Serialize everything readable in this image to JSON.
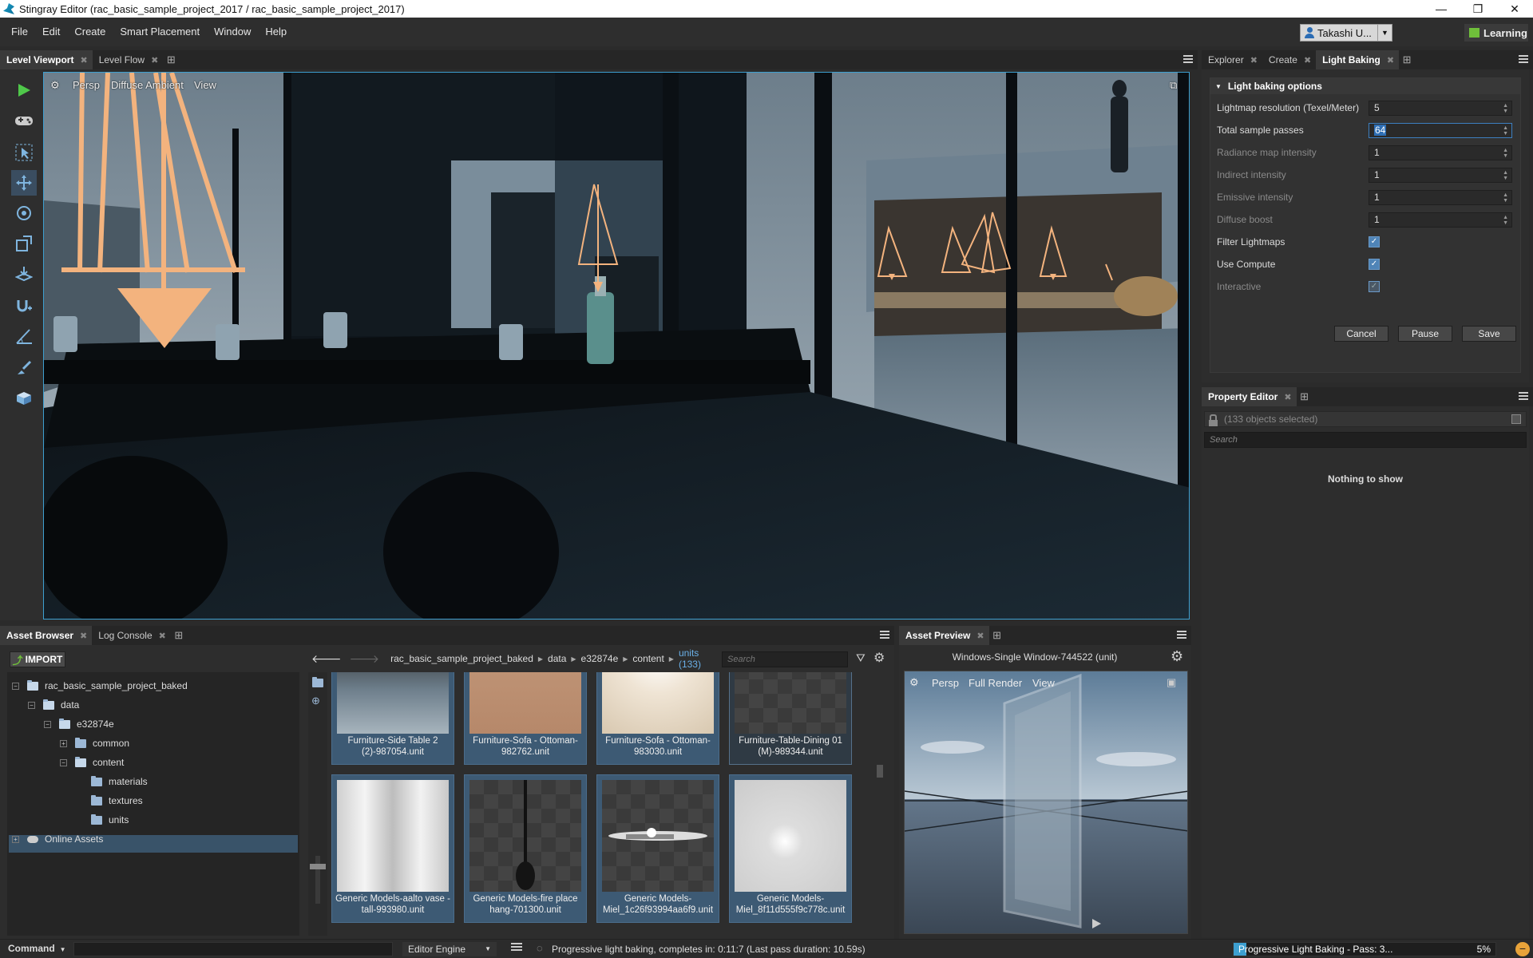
{
  "window": {
    "title": "Stingray Editor (rac_basic_sample_project_2017 / rac_basic_sample_project_2017)",
    "minimize": "—",
    "maximize": "❐",
    "close": "✕"
  },
  "menu": [
    "File",
    "Edit",
    "Create",
    "Smart Placement",
    "Window",
    "Help"
  ],
  "user": {
    "name": "Takashi U...",
    "learning_label": "Learning"
  },
  "viewport_tabs": [
    {
      "label": "Level Viewport",
      "active": true
    },
    {
      "label": "Level Flow",
      "active": false
    }
  ],
  "viewport": {
    "menu": [
      "Persp",
      "Diffuse Ambient",
      "View"
    ]
  },
  "right_tabs": [
    {
      "label": "Explorer"
    },
    {
      "label": "Create"
    },
    {
      "label": "Light Baking",
      "active": true
    }
  ],
  "light_baking": {
    "group_title": "Light baking options",
    "rows": [
      {
        "label": "Lightmap resolution (Texel/Meter)",
        "value": "5",
        "dim": false
      },
      {
        "label": "Total sample passes",
        "value": "64",
        "dim": false
      },
      {
        "label": "Radiance map intensity",
        "value": "1",
        "dim": true
      },
      {
        "label": "Indirect intensity",
        "value": "1",
        "dim": true
      },
      {
        "label": "Emissive intensity",
        "value": "1",
        "dim": true
      },
      {
        "label": "Diffuse boost",
        "value": "1",
        "dim": true
      }
    ],
    "checks": [
      {
        "label": "Filter Lightmaps",
        "checked": true,
        "dim": false
      },
      {
        "label": "Use Compute",
        "checked": true,
        "dim": false
      },
      {
        "label": "Interactive",
        "checked": true,
        "dim": true
      }
    ],
    "buttons": {
      "cancel": "Cancel",
      "pause": "Pause",
      "save": "Save"
    }
  },
  "property_editor": {
    "tab": "Property Editor",
    "filter": "(133 objects selected)",
    "search_placeholder": "Search",
    "empty": "Nothing to show"
  },
  "asset_browser": {
    "tabs": [
      {
        "label": "Asset Browser",
        "active": true
      },
      {
        "label": "Log Console",
        "active": false
      }
    ],
    "import_label": "IMPORT",
    "tree": [
      {
        "label": "rac_basic_sample_project_baked",
        "depth": 0,
        "toggle": "−",
        "icon": "folder-open"
      },
      {
        "label": "data",
        "depth": 1,
        "toggle": "−",
        "icon": "folder-open"
      },
      {
        "label": "e32874e",
        "depth": 2,
        "toggle": "−",
        "icon": "folder-open"
      },
      {
        "label": "common",
        "depth": 3,
        "toggle": "+",
        "icon": "folder"
      },
      {
        "label": "content",
        "depth": 3,
        "toggle": "−",
        "icon": "folder-open"
      },
      {
        "label": "materials",
        "depth": 4,
        "toggle": "",
        "icon": "folder"
      },
      {
        "label": "textures",
        "depth": 4,
        "toggle": "",
        "icon": "folder"
      },
      {
        "label": "units",
        "depth": 4,
        "toggle": "",
        "icon": "folder",
        "selected": true
      },
      {
        "label": "Online Assets",
        "depth": 0,
        "toggle": "+",
        "icon": "cloud"
      }
    ],
    "breadcrumb": [
      "rac_basic_sample_project_baked",
      "data",
      "e32874e",
      "content"
    ],
    "breadcrumb_current": "units (133)",
    "search_placeholder": "Search",
    "assets": [
      {
        "name": "Furniture-Side Table 2 (2)-987054.unit"
      },
      {
        "name": "Furniture-Sofa - Ottoman-982762.unit"
      },
      {
        "name": "Furniture-Sofa - Ottoman-983030.unit"
      },
      {
        "name": "Furniture-Table-Dining 01 (M)-989344.unit"
      },
      {
        "name": "Generic Models-aalto vase - tall-993980.unit"
      },
      {
        "name": "Generic Models-fire place hang-701300.unit"
      },
      {
        "name": "Generic Models-Miel_1c26f93994aa6f9.unit"
      },
      {
        "name": "Generic Models-Miel_8f11d555f9c778c.unit"
      }
    ]
  },
  "asset_preview": {
    "tab": "Asset Preview",
    "title": "Windows-Single Window-744522 (unit)",
    "menu": [
      "Persp",
      "Full Render",
      "View"
    ]
  },
  "status": {
    "command_label": "Command",
    "engine_label": "Editor Engine",
    "message": "Progressive light baking, completes in: 0:11:7 (Last pass duration: 10.59s)",
    "progress_label": "Progressive Light Baking - Pass: 3...",
    "progress_percent": "5%",
    "progress_value": 0.05,
    "accent": "#3d9fd0"
  }
}
